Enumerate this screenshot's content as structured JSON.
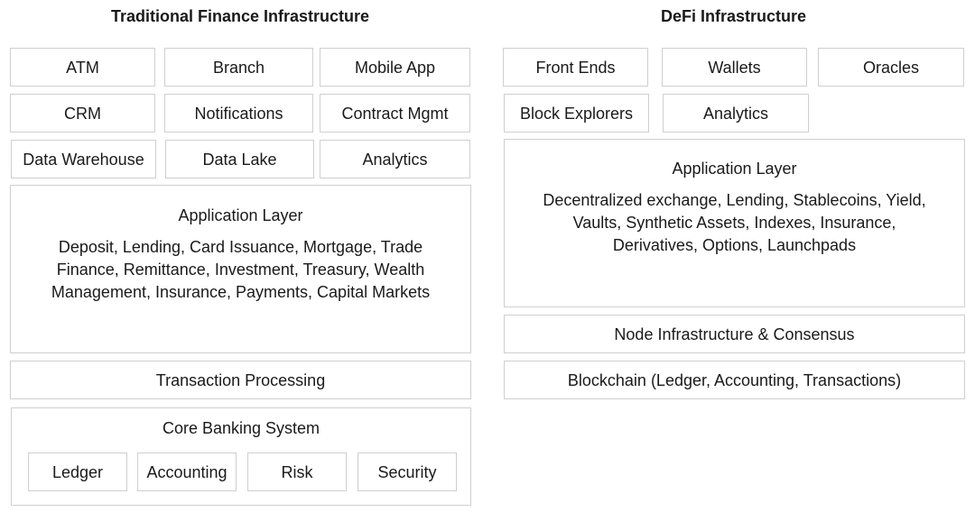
{
  "traditional": {
    "title": "Traditional Finance Infrastructure",
    "top_boxes": [
      "ATM",
      "Branch",
      "Mobile App",
      "CRM",
      "Notifications",
      "Contract Mgmt",
      "Data Warehouse",
      "Data Lake",
      "Analytics"
    ],
    "application_layer": {
      "title": "Application Layer",
      "description": "Deposit, Lending, Card Issuance, Mortgage, Trade Finance, Remittance, Investment, Treasury, Wealth Management, Insurance, Payments, Capital Markets"
    },
    "transaction_processing": "Transaction Processing",
    "core_banking": {
      "title": "Core Banking System",
      "components": [
        "Ledger",
        "Accounting",
        "Risk",
        "Security"
      ]
    }
  },
  "defi": {
    "title": "DeFi Infrastructure",
    "top_boxes": [
      "Front Ends",
      "Wallets",
      "Oracles",
      "Block Explorers",
      "Analytics"
    ],
    "application_layer": {
      "title": "Application Layer",
      "description": "Decentralized exchange, Lending, Stablecoins, Yield, Vaults, Synthetic Assets, Indexes, Insurance, Derivatives, Options, Launchpads"
    },
    "node_infrastructure": "Node Infrastructure & Consensus",
    "blockchain": "Blockchain (Ledger, Accounting, Transactions)"
  }
}
